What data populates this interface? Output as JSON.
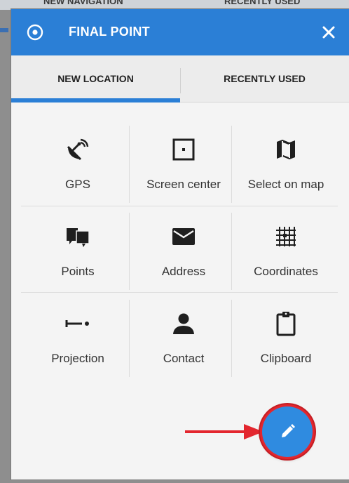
{
  "background": {
    "peek_left": "NEW NAVIGATION",
    "peek_right": "RECENTLY USED"
  },
  "titlebar": {
    "icon": "target-icon",
    "title": "FINAL POINT",
    "close_icon": "close-icon"
  },
  "tabs": [
    {
      "label": "NEW LOCATION",
      "active": true
    },
    {
      "label": "RECENTLY USED",
      "active": false
    }
  ],
  "options": [
    {
      "label": "GPS",
      "icon": "satellite-dish-icon"
    },
    {
      "label": "Screen center",
      "icon": "screen-center-icon"
    },
    {
      "label": "Select on map",
      "icon": "map-icon"
    },
    {
      "label": "Points",
      "icon": "points-icon"
    },
    {
      "label": "Address",
      "icon": "envelope-icon"
    },
    {
      "label": "Coordinates",
      "icon": "grid-icon"
    },
    {
      "label": "Projection",
      "icon": "projection-icon"
    },
    {
      "label": "Contact",
      "icon": "person-icon"
    },
    {
      "label": "Clipboard",
      "icon": "clipboard-icon"
    }
  ],
  "fab": {
    "icon": "pencil-icon"
  },
  "annotation": {
    "icon": "red-arrow-icon"
  },
  "colors": {
    "accent": "#2b7fd6",
    "fab": "#2f8be0",
    "highlight": "#e3262e"
  }
}
